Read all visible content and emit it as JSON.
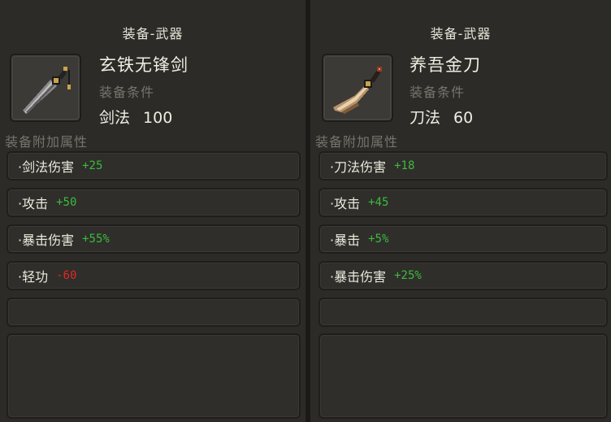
{
  "left": {
    "title": "装备-武器",
    "item_name": "玄铁无锋剑",
    "requirement_label": "装备条件",
    "requirement_skill": "剑法",
    "requirement_value": "100",
    "attributes_label": "装备附加属性",
    "attributes": [
      {
        "name": "·剑法伤害",
        "value": "+25",
        "sign": "pos"
      },
      {
        "name": "·攻击",
        "value": "+50",
        "sign": "pos"
      },
      {
        "name": "·暴击伤害",
        "value": "+55%",
        "sign": "pos"
      },
      {
        "name": "·轻功",
        "value": "-60",
        "sign": "neg"
      },
      {
        "name": "",
        "value": "",
        "sign": "pos"
      }
    ],
    "icon": "sword-icon"
  },
  "right": {
    "title": "装备-武器",
    "item_name": "养吾金刀",
    "requirement_label": "装备条件",
    "requirement_skill": "刀法",
    "requirement_value": "60",
    "attributes_label": "装备附加属性",
    "attributes": [
      {
        "name": "·刀法伤害",
        "value": "+18",
        "sign": "pos"
      },
      {
        "name": "·攻击",
        "value": "+45",
        "sign": "pos"
      },
      {
        "name": "·暴击",
        "value": "+5%",
        "sign": "pos"
      },
      {
        "name": "·暴击伤害",
        "value": "+25%",
        "sign": "pos"
      },
      {
        "name": "",
        "value": "",
        "sign": "pos"
      }
    ],
    "icon": "blade-icon"
  },
  "colors": {
    "positive": "#3dbb3d",
    "negative": "#e02828",
    "muted": "#77746b",
    "panel": "#2c2b28"
  }
}
